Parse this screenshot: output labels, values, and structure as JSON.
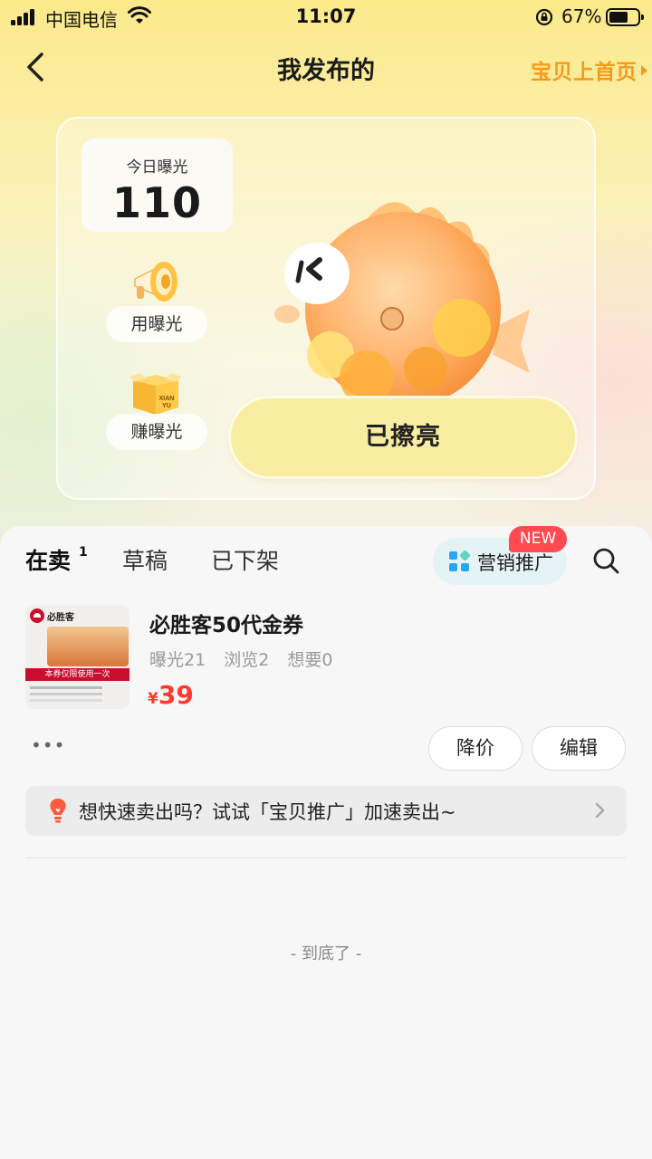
{
  "status_bar": {
    "carrier": "中国电信",
    "time": "11:07",
    "battery_percent": "67%",
    "battery_level": 0.67
  },
  "nav": {
    "title": "我发布的",
    "promo_link": "宝贝上首页"
  },
  "hero": {
    "today_label": "今日曝光",
    "today_value": "110",
    "use_label": "用曝光",
    "earn_label": "赚曝光",
    "box_text_1": "XIAN",
    "box_text_2": "YU",
    "shine_label": "已擦亮"
  },
  "tabs": [
    {
      "label": "在卖",
      "count": "1",
      "active": true
    },
    {
      "label": "草稿",
      "active": false
    },
    {
      "label": "已下架",
      "active": false
    }
  ],
  "marketing": {
    "label": "营销推广",
    "badge": "NEW"
  },
  "item": {
    "thumb_brand": "必胜客",
    "thumb_band": "本券仅限使用一次",
    "title": "必胜客50代金券",
    "stats": {
      "exposure": "曝光21",
      "views": "浏览2",
      "wants": "想要0"
    },
    "currency": "¥",
    "price": "39",
    "more": "•••",
    "btn_reduce_price": "降价",
    "btn_edit": "编辑"
  },
  "tip": {
    "text": "想快速卖出吗？试试「宝贝推广」加速卖出~"
  },
  "footer": {
    "end_text": "- 到底了 -"
  },
  "colors": {
    "accent_orange": "#f79a1c",
    "price_red": "#ff3b30",
    "badge_red": "#ff4a4f",
    "button_yellow": "#f8eda0",
    "tab_highlight": "#ffe14d"
  }
}
